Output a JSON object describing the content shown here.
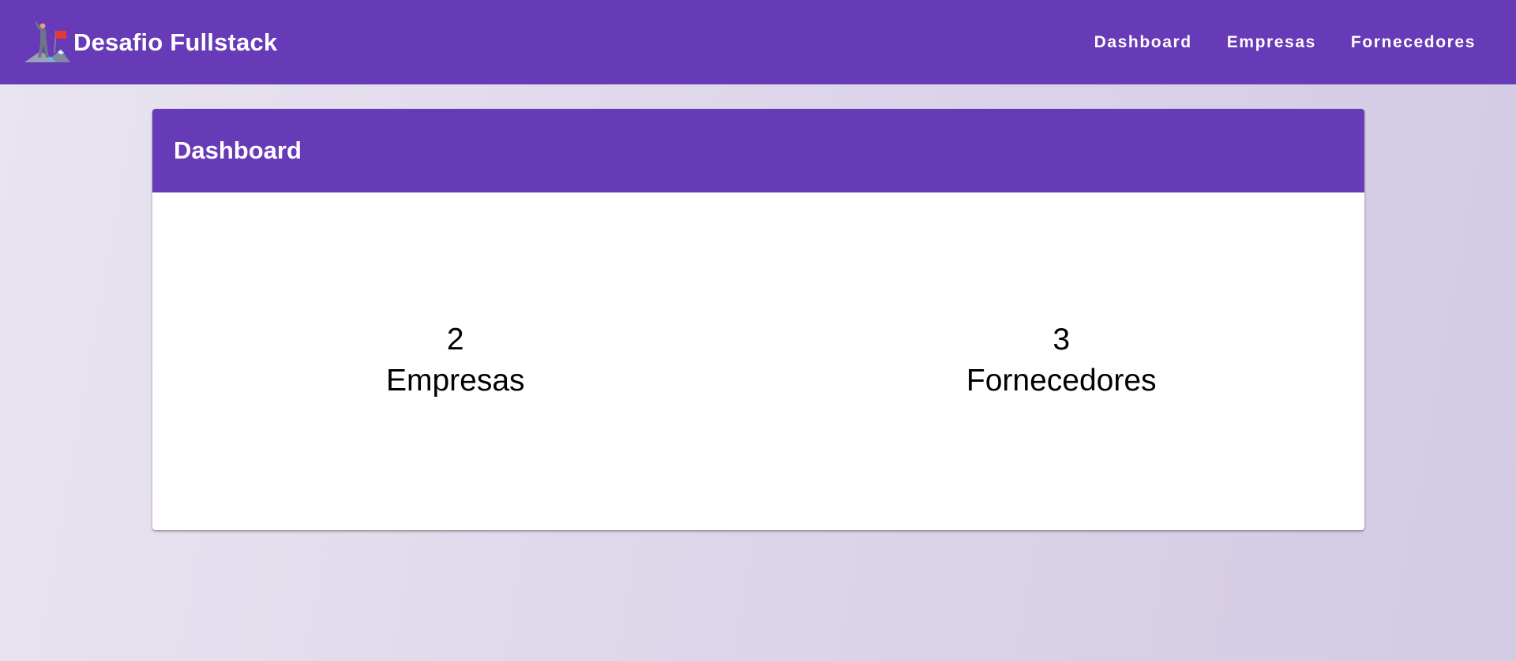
{
  "app": {
    "title": "Desafio Fullstack",
    "logo_icon": "mountain-climber-flag-icon"
  },
  "nav": {
    "items": [
      {
        "label": "Dashboard"
      },
      {
        "label": "Empresas"
      },
      {
        "label": "Fornecedores"
      }
    ]
  },
  "card": {
    "title": "Dashboard",
    "stats": [
      {
        "value": "2",
        "label": "Empresas"
      },
      {
        "value": "3",
        "label": "Fornecedores"
      }
    ]
  },
  "colors": {
    "primary": "#673ab7",
    "background_start": "#e9e4f0",
    "background_end": "#d3cae4",
    "card_background": "#ffffff",
    "text_on_primary": "#ffffff",
    "text": "#000000"
  }
}
